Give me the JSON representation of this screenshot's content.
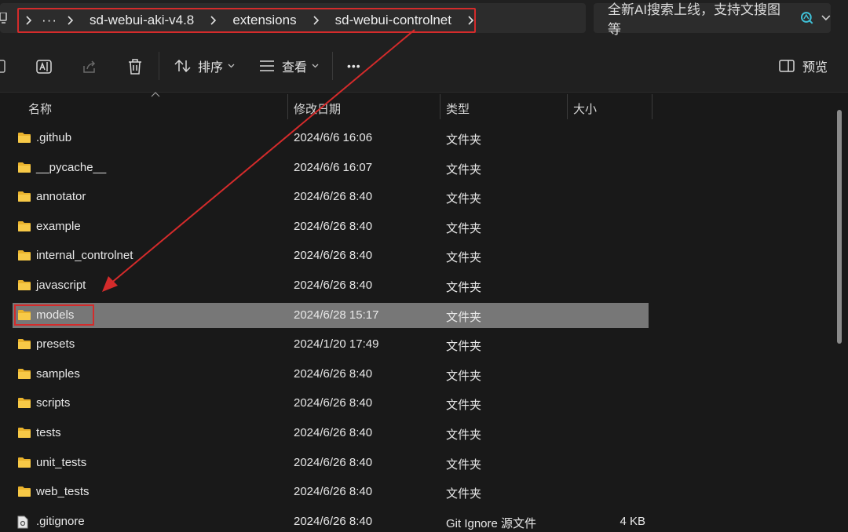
{
  "breadcrumb": {
    "overflow_label": "···",
    "segments": [
      "sd-webui-aki-v4.8",
      "extensions",
      "sd-webui-controlnet"
    ]
  },
  "search": {
    "text": "全新AI搜索上线，支持文搜图等"
  },
  "toolbar": {
    "sort_label": "排序",
    "view_label": "查看",
    "more_label": "•••",
    "preview_label": "预览"
  },
  "columns": {
    "name": "名称",
    "modified": "修改日期",
    "type": "类型",
    "size": "大小"
  },
  "files": [
    {
      "name": ".github",
      "modified": "2024/6/6 16:06",
      "type": "文件夹",
      "size": "",
      "icon": "folder-icon"
    },
    {
      "name": "__pycache__",
      "modified": "2024/6/6 16:07",
      "type": "文件夹",
      "size": "",
      "icon": "folder-icon"
    },
    {
      "name": "annotator",
      "modified": "2024/6/26 8:40",
      "type": "文件夹",
      "size": "",
      "icon": "folder-icon"
    },
    {
      "name": "example",
      "modified": "2024/6/26 8:40",
      "type": "文件夹",
      "size": "",
      "icon": "folder-icon"
    },
    {
      "name": "internal_controlnet",
      "modified": "2024/6/26 8:40",
      "type": "文件夹",
      "size": "",
      "icon": "folder-icon"
    },
    {
      "name": "javascript",
      "modified": "2024/6/26 8:40",
      "type": "文件夹",
      "size": "",
      "icon": "folder-icon"
    },
    {
      "name": "models",
      "modified": "2024/6/28 15:17",
      "type": "文件夹",
      "size": "",
      "icon": "folder-icon",
      "selected": true
    },
    {
      "name": "presets",
      "modified": "2024/1/20 17:49",
      "type": "文件夹",
      "size": "",
      "icon": "folder-icon"
    },
    {
      "name": "samples",
      "modified": "2024/6/26 8:40",
      "type": "文件夹",
      "size": "",
      "icon": "folder-icon"
    },
    {
      "name": "scripts",
      "modified": "2024/6/26 8:40",
      "type": "文件夹",
      "size": "",
      "icon": "folder-icon"
    },
    {
      "name": "tests",
      "modified": "2024/6/26 8:40",
      "type": "文件夹",
      "size": "",
      "icon": "folder-icon"
    },
    {
      "name": "unit_tests",
      "modified": "2024/6/26 8:40",
      "type": "文件夹",
      "size": "",
      "icon": "folder-icon"
    },
    {
      "name": "web_tests",
      "modified": "2024/6/26 8:40",
      "type": "文件夹",
      "size": "",
      "icon": "folder-icon"
    },
    {
      "name": ".gitignore",
      "modified": "2024/6/26 8:40",
      "type": "Git Ignore 源文件",
      "size": "4 KB",
      "icon": "file-icon"
    }
  ],
  "colors": {
    "annotation": "#d42b2b",
    "folder": "#f3c13a",
    "selected_row": "#777777"
  }
}
